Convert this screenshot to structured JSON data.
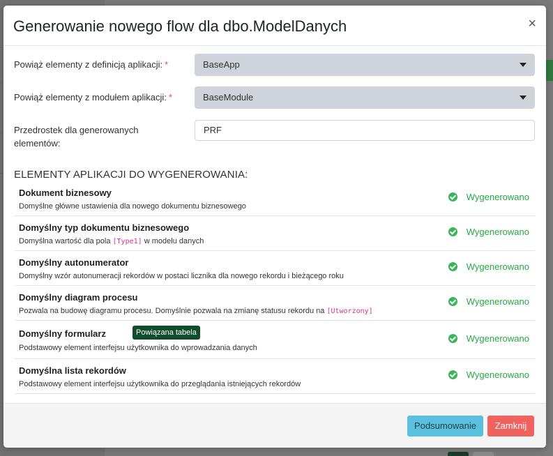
{
  "modal": {
    "title": "Generowanie nowego flow dla dbo.ModelDanych",
    "close_glyph": "×"
  },
  "form": {
    "app_definition": {
      "label": "Powiąż elementy z definicją aplikacji:",
      "required_mark": "*",
      "value": "BaseApp"
    },
    "app_module": {
      "label": "Powiąż elementy z modułem aplikacji:",
      "required_mark": "*",
      "value": "BaseModule"
    },
    "prefix": {
      "label_line1": "Przedrostek dla generowanych",
      "label_line2": "elementów:",
      "value": "PRF"
    }
  },
  "section": {
    "title": "ELEMENTY APLIKACJI DO WYGENEROWANIA:"
  },
  "items": [
    {
      "title": "Dokument biznesowy",
      "desc": "Domyślne główne ustawienia dla nowego dokumentu biznesowego",
      "status": "Wygenerowano"
    },
    {
      "title": "Domyślny typ dokumentu biznesowego",
      "desc_before": "Domyślna wartość dla pola ",
      "desc_code": "[Type1]",
      "desc_after": " w modelu danych",
      "status": "Wygenerowano"
    },
    {
      "title": "Domyślny autonumerator",
      "desc": "Domyślny wzór autonumeracji rekordów w postaci licznika dla nowego rekordu i bieżącego roku",
      "status": "Wygenerowano"
    },
    {
      "title": "Domyślny diagram procesu",
      "desc_before": "Pozwala na budowę diagramu procesu. Domyślnie pozwala na zmianę statusu rekordu na ",
      "desc_code": "[Utworzony]",
      "desc_after": "",
      "status": "Wygenerowano"
    },
    {
      "title": "Domyślny formularz",
      "badge": "Powiązana tabela",
      "desc": "Podstawowy element interfejsu użytkownika do wprowadzania danych",
      "status": "Wygenerowano"
    },
    {
      "title": "Domyślna lista rekordów",
      "desc": "Podstawowy element interfejsu użytkownika do przeglądania istniejących rekordów",
      "status": "Wygenerowano"
    }
  ],
  "footer": {
    "summary_label": "Podsumowanie",
    "close_label": "Zamknij"
  },
  "colors": {
    "success": "#28a745",
    "info_button": "#5bc0de",
    "danger_button": "#f0625d",
    "badge": "#0f4d2a"
  }
}
